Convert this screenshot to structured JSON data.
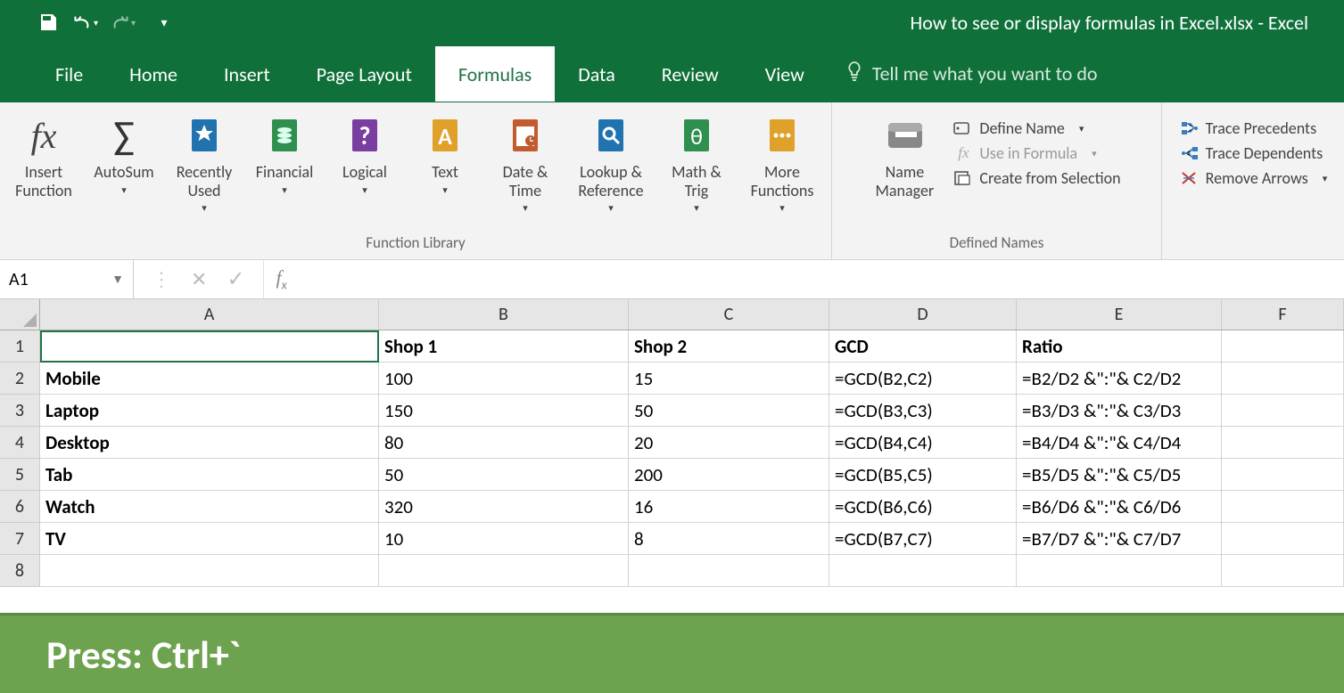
{
  "title": "How to see or display formulas in Excel.xlsx  -  Excel",
  "tabs": [
    "File",
    "Home",
    "Insert",
    "Page Layout",
    "Formulas",
    "Data",
    "Review",
    "View"
  ],
  "active_tab": 4,
  "tell_me_placeholder": "Tell me what you want to do",
  "ribbon": {
    "function_library": {
      "label": "Function Library",
      "items": [
        {
          "label": "Insert\nFunction",
          "icon": "fx"
        },
        {
          "label": "AutoSum",
          "icon": "sigma",
          "drop": true
        },
        {
          "label": "Recently\nUsed",
          "icon": "star",
          "drop": true
        },
        {
          "label": "Financial",
          "icon": "coins",
          "drop": true
        },
        {
          "label": "Logical",
          "icon": "question",
          "drop": true
        },
        {
          "label": "Text",
          "icon": "A",
          "drop": true
        },
        {
          "label": "Date &\nTime",
          "icon": "calendar",
          "drop": true
        },
        {
          "label": "Lookup &\nReference",
          "icon": "lookup",
          "drop": true
        },
        {
          "label": "Math &\nTrig",
          "icon": "theta",
          "drop": true
        },
        {
          "label": "More\nFunctions",
          "icon": "more",
          "drop": true
        }
      ]
    },
    "defined_names": {
      "label": "Defined Names",
      "big": {
        "label": "Name\nManager",
        "icon": "name"
      },
      "small": [
        {
          "label": "Define Name",
          "icon": "tag",
          "drop": true
        },
        {
          "label": "Use in Formula",
          "icon": "fx-small",
          "drop": true,
          "disabled": true
        },
        {
          "label": "Create from Selection",
          "icon": "create"
        }
      ]
    },
    "auditing": {
      "small": [
        {
          "label": "Trace Precedents",
          "icon": "prec"
        },
        {
          "label": "Trace Dependents",
          "icon": "dep"
        },
        {
          "label": "Remove Arrows",
          "icon": "remove",
          "drop": true
        }
      ]
    }
  },
  "name_box": "A1",
  "formula_value": "",
  "columns": [
    "A",
    "B",
    "C",
    "D",
    "E",
    "F"
  ],
  "rows": [
    {
      "n": 1,
      "cells": [
        "",
        "Shop 1",
        "Shop 2",
        "GCD",
        "Ratio",
        ""
      ]
    },
    {
      "n": 2,
      "cells": [
        "Mobile",
        "100",
        "15",
        "=GCD(B2,C2)",
        "=B2/D2 &\":\"& C2/D2",
        ""
      ]
    },
    {
      "n": 3,
      "cells": [
        "Laptop",
        "150",
        "50",
        "=GCD(B3,C3)",
        "=B3/D3 &\":\"& C3/D3",
        ""
      ]
    },
    {
      "n": 4,
      "cells": [
        "Desktop",
        "80",
        "20",
        "=GCD(B4,C4)",
        "=B4/D4 &\":\"& C4/D4",
        ""
      ]
    },
    {
      "n": 5,
      "cells": [
        "Tab",
        "50",
        "200",
        "=GCD(B5,C5)",
        "=B5/D5 &\":\"& C5/D5",
        ""
      ]
    },
    {
      "n": 6,
      "cells": [
        "Watch",
        "320",
        "16",
        "=GCD(B6,C6)",
        "=B6/D6 &\":\"& C6/D6",
        ""
      ]
    },
    {
      "n": 7,
      "cells": [
        "TV",
        "10",
        "8",
        "=GCD(B7,C7)",
        "=B7/D7 &\":\"& C7/D7",
        ""
      ]
    },
    {
      "n": 8,
      "cells": [
        "",
        "",
        "",
        "",
        "",
        ""
      ]
    }
  ],
  "banner": "Press: Ctrl+`"
}
